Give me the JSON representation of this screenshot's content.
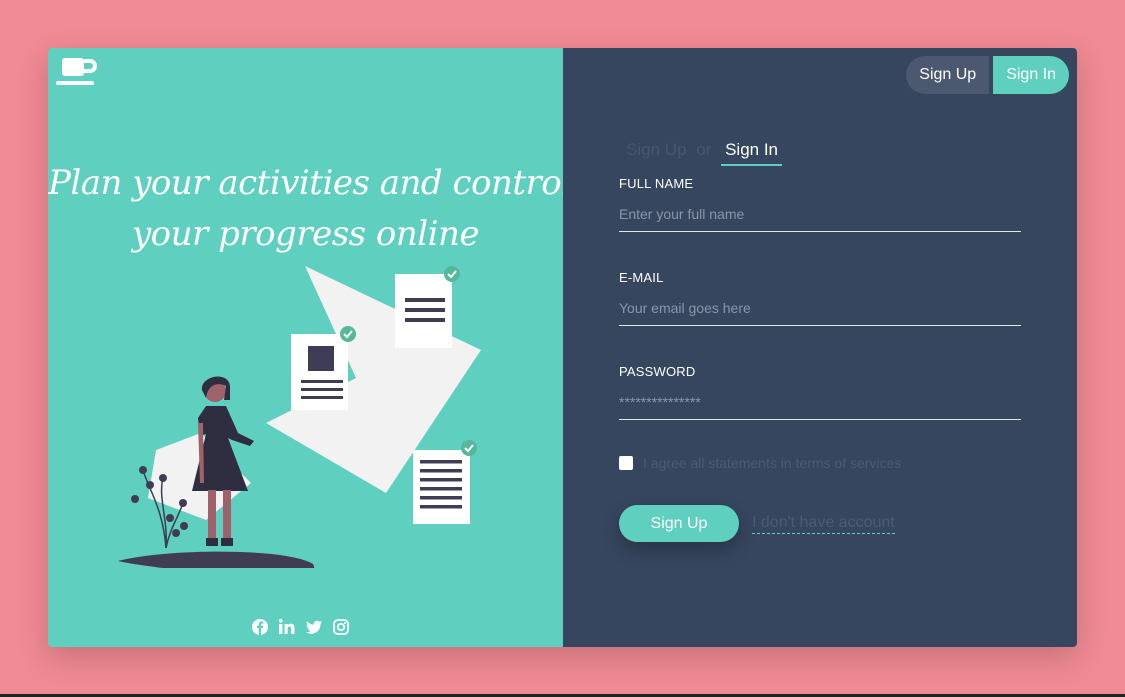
{
  "brand": {
    "logo_icon": "coffee-cup-icon"
  },
  "hero": {
    "headline_line1": "Plan your activities and control",
    "headline_line2": "your progress online"
  },
  "social": [
    "facebook-icon",
    "linkedin-icon",
    "twitter-icon",
    "instagram-icon"
  ],
  "toggle": {
    "signup_label": "Sign Up",
    "signin_label": "Sign In"
  },
  "tabs": {
    "signup": "Sign Up",
    "or": "or",
    "signin": "Sign In"
  },
  "form": {
    "full_name": {
      "label": "FULL NAME",
      "placeholder": "Enter your full name"
    },
    "email": {
      "label": "E-MAIL",
      "placeholder": "Your email goes here"
    },
    "password": {
      "label": "PASSWORD",
      "placeholder": "***************"
    },
    "agree_text": "I agree all statements in terms of services",
    "submit_label": "Sign Up",
    "no_account_link": "I don't have account"
  },
  "colors": {
    "background": "#f08a93",
    "teal": "#5fcfbf",
    "panel": "#36465f"
  }
}
